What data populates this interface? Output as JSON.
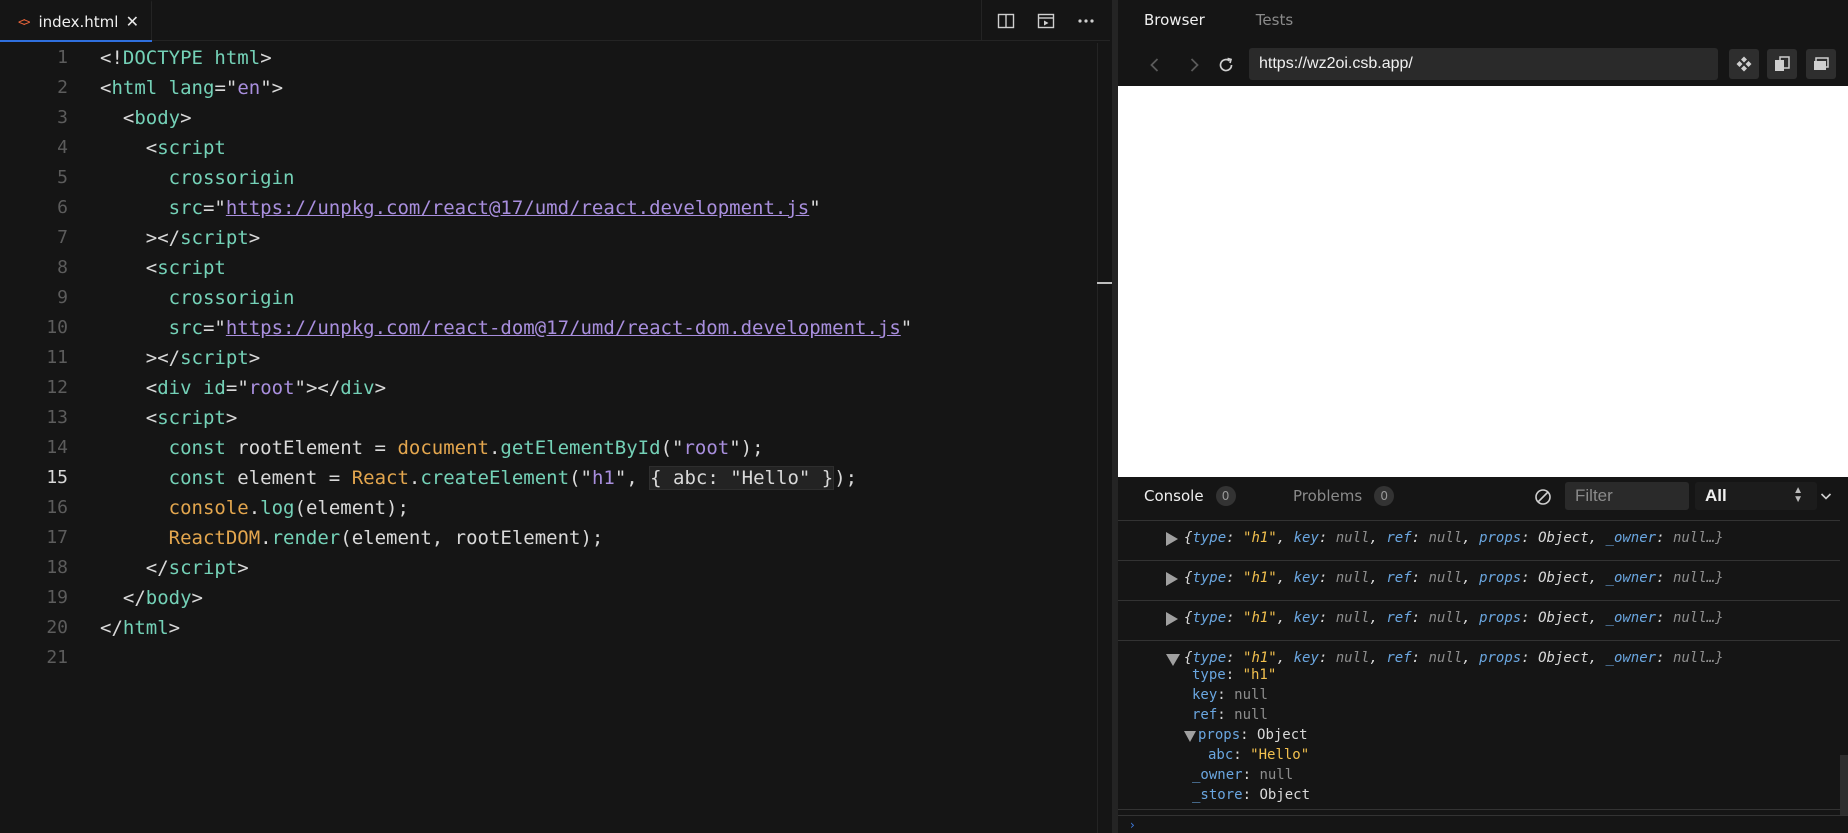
{
  "editor": {
    "tab_label": "index.html",
    "lines": [
      {
        "n": "1",
        "tokens": [
          [
            "t-punc",
            "<!"
          ],
          [
            "t-tag",
            "DOCTYPE"
          ],
          [
            "t-punc",
            " "
          ],
          [
            "t-attr",
            "html"
          ],
          [
            "t-punc",
            ">"
          ]
        ]
      },
      {
        "n": "2",
        "tokens": [
          [
            "t-punc",
            "<"
          ],
          [
            "t-tag",
            "html"
          ],
          [
            "t-punc",
            " "
          ],
          [
            "t-attr",
            "lang"
          ],
          [
            "t-punc",
            "=\""
          ],
          [
            "t-str",
            "en"
          ],
          [
            "t-punc",
            "\">"
          ]
        ]
      },
      {
        "n": "3",
        "tokens": [
          [
            "t-punc",
            "  <"
          ],
          [
            "t-tag",
            "body"
          ],
          [
            "t-punc",
            ">"
          ]
        ]
      },
      {
        "n": "4",
        "tokens": [
          [
            "t-punc",
            "    <"
          ],
          [
            "t-tag",
            "script"
          ]
        ]
      },
      {
        "n": "5",
        "tokens": [
          [
            "t-punc",
            "      "
          ],
          [
            "t-attr",
            "crossorigin"
          ]
        ]
      },
      {
        "n": "6",
        "tokens": [
          [
            "t-punc",
            "      "
          ],
          [
            "t-attr",
            "src"
          ],
          [
            "t-punc",
            "=\""
          ],
          [
            "t-url",
            "https://unpkg.com/react@17/umd/react.development.js"
          ],
          [
            "t-punc",
            "\""
          ]
        ]
      },
      {
        "n": "7",
        "tokens": [
          [
            "t-punc",
            "    ></"
          ],
          [
            "t-tag",
            "script"
          ],
          [
            "t-punc",
            ">"
          ]
        ]
      },
      {
        "n": "8",
        "tokens": [
          [
            "t-punc",
            "    <"
          ],
          [
            "t-tag",
            "script"
          ]
        ]
      },
      {
        "n": "9",
        "tokens": [
          [
            "t-punc",
            "      "
          ],
          [
            "t-attr",
            "crossorigin"
          ]
        ]
      },
      {
        "n": "10",
        "tokens": [
          [
            "t-punc",
            "      "
          ],
          [
            "t-attr",
            "src"
          ],
          [
            "t-punc",
            "=\""
          ],
          [
            "t-url",
            "https://unpkg.com/react-dom@17/umd/react-dom.development.js"
          ],
          [
            "t-punc",
            "\""
          ]
        ]
      },
      {
        "n": "11",
        "tokens": [
          [
            "t-punc",
            "    ></"
          ],
          [
            "t-tag",
            "script"
          ],
          [
            "t-punc",
            ">"
          ]
        ]
      },
      {
        "n": "12",
        "tokens": [
          [
            "t-punc",
            "    <"
          ],
          [
            "t-tag",
            "div"
          ],
          [
            "t-punc",
            " "
          ],
          [
            "t-attr",
            "id"
          ],
          [
            "t-punc",
            "=\""
          ],
          [
            "t-str",
            "root"
          ],
          [
            "t-punc",
            "\"></"
          ],
          [
            "t-tag",
            "div"
          ],
          [
            "t-punc",
            ">"
          ]
        ]
      },
      {
        "n": "13",
        "tokens": [
          [
            "t-punc",
            "    <"
          ],
          [
            "t-tag",
            "script"
          ],
          [
            "t-punc",
            ">"
          ]
        ]
      },
      {
        "n": "14",
        "tokens": [
          [
            "t-punc",
            "      "
          ],
          [
            "t-kw",
            "const"
          ],
          [
            "t-id",
            " rootElement = "
          ],
          [
            "t-obj",
            "document"
          ],
          [
            "t-punc",
            "."
          ],
          [
            "t-fn",
            "getElementById"
          ],
          [
            "t-punc",
            "(\""
          ],
          [
            "t-str",
            "root"
          ],
          [
            "t-punc",
            "\");"
          ]
        ]
      },
      {
        "n": "15",
        "tokens": [
          [
            "t-punc",
            "      "
          ],
          [
            "t-kw",
            "const"
          ],
          [
            "t-id",
            " element = "
          ],
          [
            "t-obj",
            "React"
          ],
          [
            "t-punc",
            "."
          ],
          [
            "t-fn",
            "createElement"
          ],
          [
            "t-punc",
            "(\""
          ],
          [
            "t-str",
            "h1"
          ],
          [
            "t-punc",
            "\", "
          ],
          [
            "t-hl",
            "{ abc: \"Hello\" }"
          ],
          [
            "t-punc",
            ");"
          ]
        ]
      },
      {
        "n": "16",
        "tokens": [
          [
            "t-punc",
            "      "
          ],
          [
            "t-obj",
            "console"
          ],
          [
            "t-punc",
            "."
          ],
          [
            "t-fn",
            "log"
          ],
          [
            "t-punc",
            "(element);"
          ]
        ]
      },
      {
        "n": "17",
        "tokens": [
          [
            "t-punc",
            "      "
          ],
          [
            "t-obj",
            "ReactDOM"
          ],
          [
            "t-punc",
            "."
          ],
          [
            "t-fn",
            "render"
          ],
          [
            "t-punc",
            "(element, rootElement);"
          ]
        ]
      },
      {
        "n": "18",
        "tokens": [
          [
            "t-punc",
            "    </"
          ],
          [
            "t-tag",
            "script"
          ],
          [
            "t-punc",
            ">"
          ]
        ]
      },
      {
        "n": "19",
        "tokens": [
          [
            "t-punc",
            "  </"
          ],
          [
            "t-tag",
            "body"
          ],
          [
            "t-punc",
            ">"
          ]
        ]
      },
      {
        "n": "20",
        "tokens": [
          [
            "t-punc",
            "</"
          ],
          [
            "t-tag",
            "html"
          ],
          [
            "t-punc",
            ">"
          ]
        ]
      },
      {
        "n": "21",
        "tokens": []
      }
    ],
    "active_line": "15"
  },
  "preview": {
    "tabs": [
      "Browser",
      "Tests"
    ],
    "active_tab": "Browser",
    "url": "https://wz2oi.csb.app/"
  },
  "console": {
    "tab_console": "Console",
    "console_count": "0",
    "tab_problems": "Problems",
    "problems_count": "0",
    "filter_placeholder": "Filter",
    "level": "All",
    "summary": {
      "open": "{",
      "type_key": "type",
      "type_val": "\"h1\"",
      "key_key": "key",
      "key_val": "null",
      "ref_key": "ref",
      "ref_val": "null",
      "props_key": "props",
      "props_val": "Object",
      "owner_key": "_owner",
      "owner_val": "null…}"
    },
    "expanded": {
      "type_key": "type",
      "type_val": "\"h1\"",
      "key_key": "key",
      "key_val": "null",
      "ref_key": "ref",
      "ref_val": "null",
      "props_key": "props",
      "props_val": "Object",
      "abc_key": "abc",
      "abc_val": "\"Hello\"",
      "owner_key": "_owner",
      "owner_val": "null",
      "store_key": "_store",
      "store_val": "Object"
    }
  }
}
